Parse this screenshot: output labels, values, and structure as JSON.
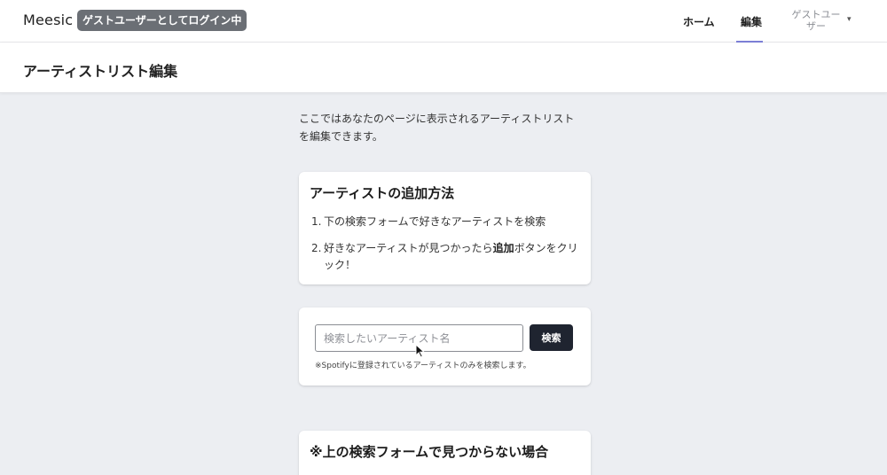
{
  "navbar": {
    "brand": "Meesic",
    "guest_badge": "ゲストユーザーとしてログイン中",
    "links": [
      {
        "label": "ホーム"
      },
      {
        "label": "編集"
      }
    ],
    "user_menu": {
      "line1": "ゲストユー",
      "line2": "ザー",
      "icon": "chevron-down-icon"
    }
  },
  "header": {
    "title": "アーティストリスト編集"
  },
  "intro": {
    "line1": "ここではあなたのページに表示されるアーティストリスト",
    "line2": "を編集できます。"
  },
  "how_to": {
    "title": "アーティストの追加方法",
    "step1_num": "1.",
    "step1": "下の検索フォームで好きなアーティストを検索",
    "step2_num": "2.",
    "step2_pre": "好きなアーティストが見つかったら",
    "step2_bold": "追加",
    "step2_post": "ボタンをクリック！"
  },
  "search": {
    "placeholder": "検索したいアーティスト名",
    "value": "",
    "button": "検索",
    "note": "※Spotifyに登録されているアーティストのみを検索します。"
  },
  "not_found": {
    "title": "※上の検索フォームで見つからない場合"
  },
  "colors": {
    "page_bg": "#eceef2",
    "badge_bg": "#6b6f75",
    "button_bg": "#1f2430",
    "nav_active_underline": "#7c7fd6"
  }
}
